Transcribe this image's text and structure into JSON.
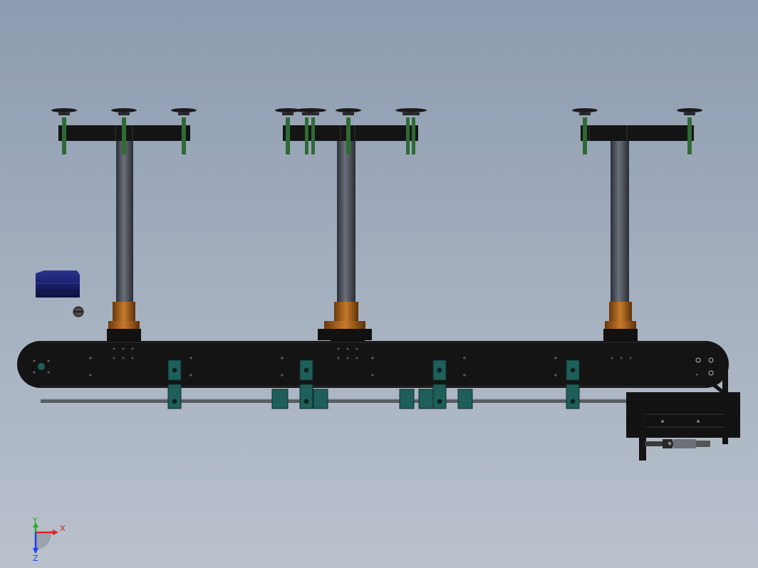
{
  "viewport": {
    "background_top": "#8d9bb0",
    "background_bottom": "#b9c1cc"
  },
  "model": {
    "frame_color": "#141414",
    "column_color": "#4b5059",
    "bearing_color": "#b86a1e",
    "bracket_color": "#1e5f5a",
    "suction_stem_color": "#2f6a35",
    "motor_color": "#14185a"
  },
  "triad": {
    "x_label": "X",
    "y_label": "Y",
    "z_label": "Z",
    "x_color": "#e02020",
    "y_color": "#20b020",
    "z_color": "#2040e0"
  }
}
